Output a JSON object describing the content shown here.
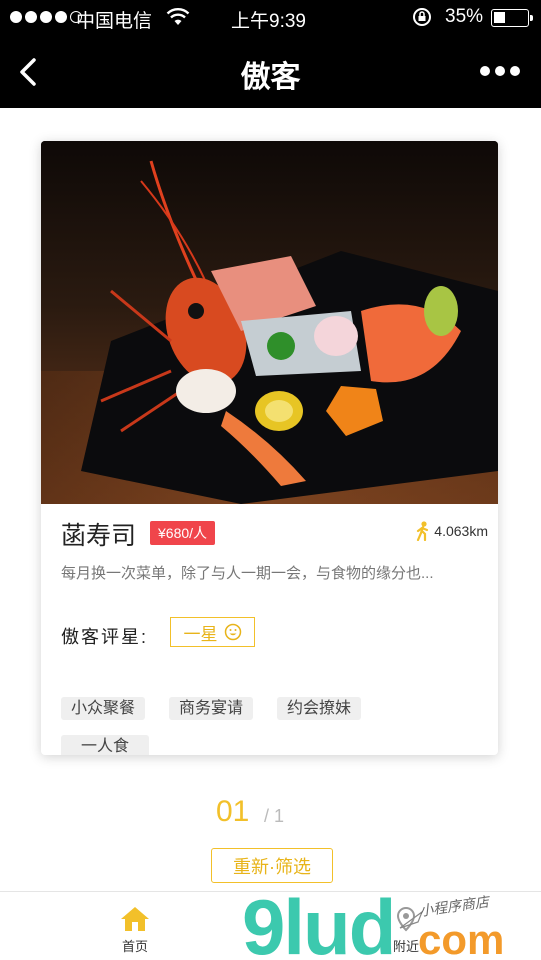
{
  "status_bar": {
    "carrier": "中国电信",
    "time": "上午9:39",
    "battery": "35%",
    "battery_level": 0.35
  },
  "nav": {
    "title": "傲客"
  },
  "card": {
    "name": "菡寿司",
    "price": "¥680/人",
    "distance": "4.063km",
    "description": "每月换一次菜单，除了与人一期一会，与食物的缘分也...",
    "rating_label": "傲客评星:",
    "rating_value": "一星",
    "tags": [
      "小众聚餐",
      "商务宴请",
      "约会撩妹",
      "一人食"
    ]
  },
  "pager": {
    "current": "01",
    "total": "/ 1"
  },
  "refilter_label": "重新·筛选",
  "tabbar": {
    "home": "首页",
    "nearby": "附近"
  },
  "watermark": {
    "logo": "9lud",
    "domain": "com",
    "tagline": "小程序商店"
  },
  "colors": {
    "accent": "#f2c02a",
    "price_bg": "#f0454b",
    "bar_bg": "#000000"
  }
}
